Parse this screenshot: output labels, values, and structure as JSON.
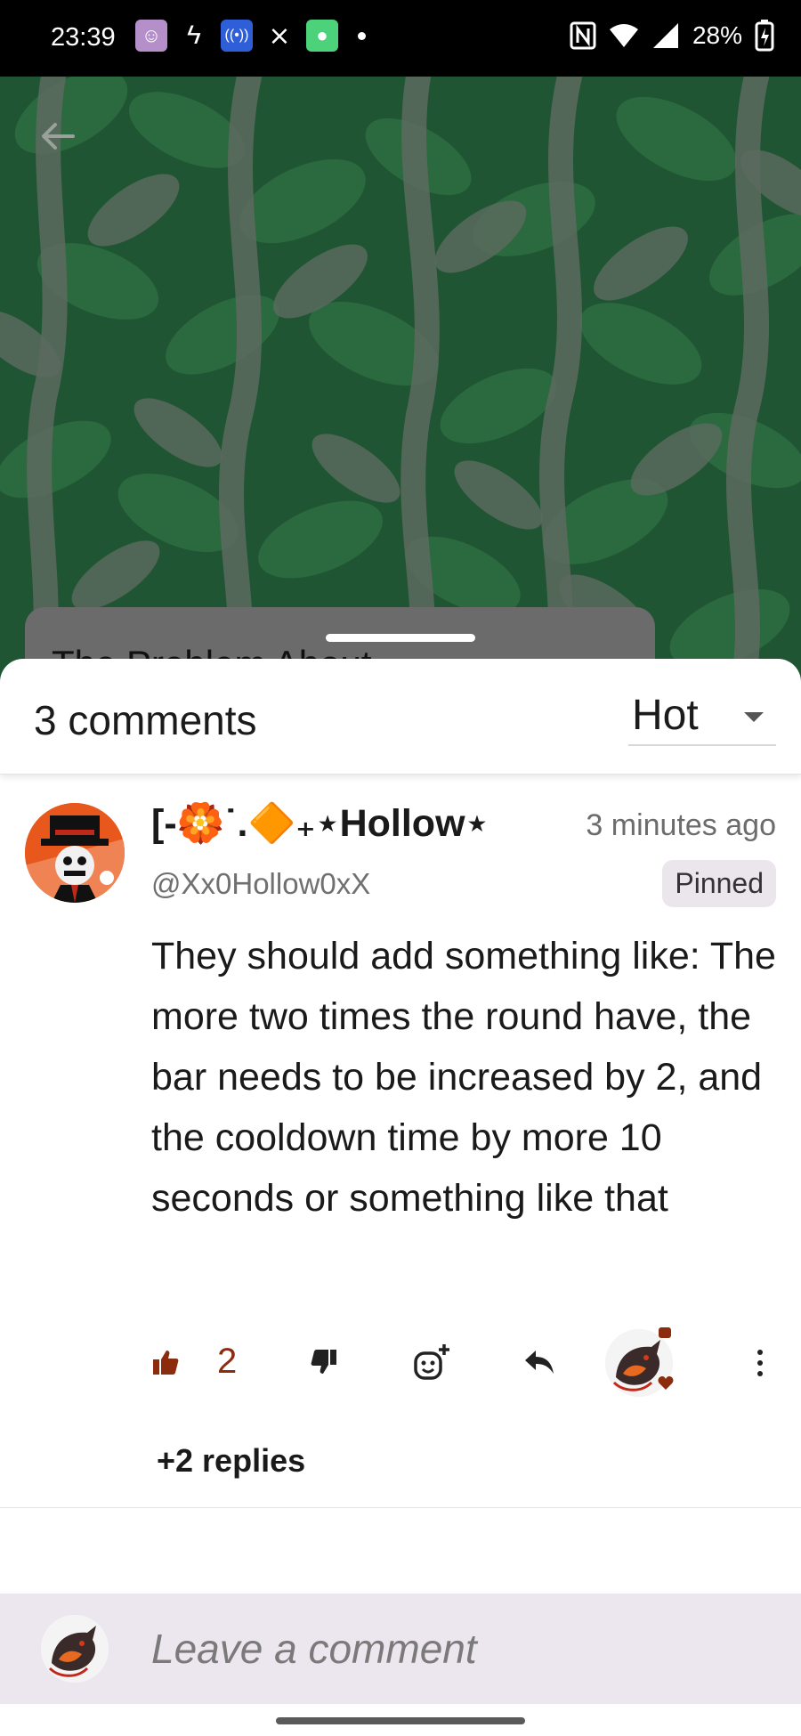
{
  "status_bar": {
    "time": "23:39",
    "battery": "28%",
    "icons": [
      "avatar-notification-icon",
      "bolt-icon",
      "radio-icon",
      "capcut-icon",
      "message-icon",
      "dot-icon",
      "nfc-icon",
      "wifi-icon",
      "signal-icon",
      "battery-icon"
    ]
  },
  "header": {
    "back_icon": "arrow-left-icon",
    "card_title_peek": "The Problem About"
  },
  "comments_sheet": {
    "count_label": "3 comments",
    "sort_label": "Hot",
    "comment": {
      "author": "[-🏵️˙.🔶₊⋆Hollow⋆",
      "timestamp": "3 minutes ago",
      "handle": "@Xx0Hollow0xX",
      "badge": "Pinned",
      "text": "They should add something like: The more two times the round have, the bar needs to be increased by 2, and the cooldown time by more 10 seconds or something like that",
      "like_count": "2",
      "replies_label": "+2 replies"
    },
    "compose": {
      "placeholder": "Leave a comment"
    }
  },
  "colors": {
    "header_bg": "#1f5533",
    "leaf_dark": "#2c6b40",
    "stem": "#5d6b5f",
    "like_accent": "#8b2c0e",
    "compose_bg": "#ece6ee",
    "badge_bg": "#ebe6ec"
  }
}
